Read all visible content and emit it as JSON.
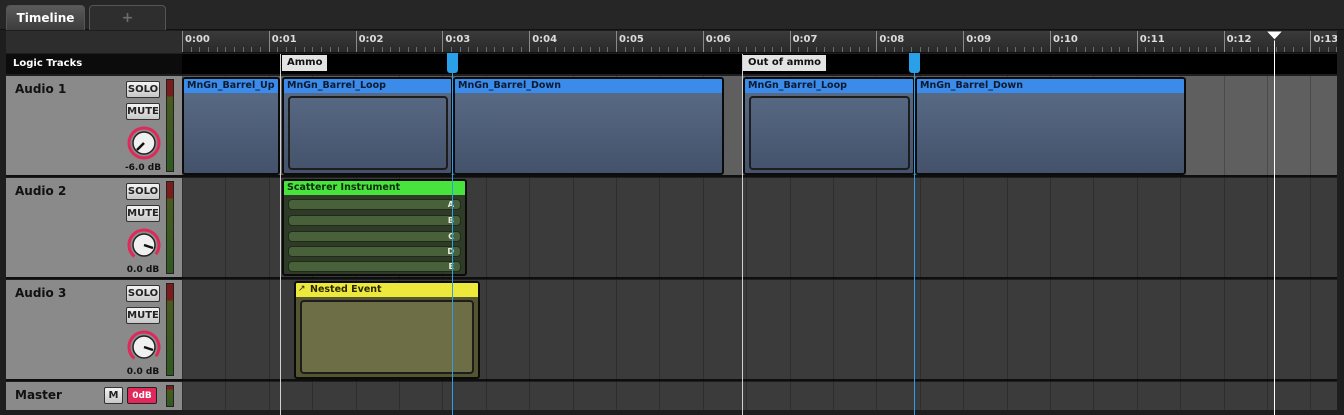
{
  "tabs": {
    "timeline": "Timeline",
    "add": "+"
  },
  "ruler": {
    "labels": [
      "0:00",
      "0:01",
      "0:02",
      "0:03",
      "0:04",
      "0:05",
      "0:06",
      "0:07",
      "0:08",
      "0:09",
      "0:10",
      "0:11",
      "0:12",
      "0:13"
    ],
    "playhead": "0:12.6"
  },
  "logic": {
    "title": "Logic Tracks",
    "markers": [
      {
        "label": "Ammo",
        "time": "0:01"
      },
      {
        "label": "Out of ammo",
        "time": "0:06.7"
      }
    ],
    "loop_start": "0:03.1",
    "loop_end": "0:08.3"
  },
  "tracks": [
    {
      "name": "Audio 1",
      "solo": "SOLO",
      "mute": "MUTE",
      "volume": "-6.0 dB",
      "meter_level": 0.82,
      "clips": [
        {
          "label": "MnGn_Barrel_Up",
          "kind": "single"
        },
        {
          "label": "MnGn_Barrel_Loop",
          "kind": "loop"
        },
        {
          "label": "MnGn_Barrel_Down",
          "kind": "single"
        },
        {
          "label": "MnGn_Barrel_Loop",
          "kind": "loop"
        },
        {
          "label": "MnGn_Barrel_Down",
          "kind": "single"
        }
      ]
    },
    {
      "name": "Audio 2",
      "solo": "SOLO",
      "mute": "MUTE",
      "volume": "0.0 dB",
      "meter_level": 0.82,
      "clips": [
        {
          "label": "Scatterer Instrument",
          "kind": "scatterer",
          "rows": [
            "A",
            "B",
            "C",
            "D",
            "E"
          ]
        }
      ]
    },
    {
      "name": "Audio 3",
      "solo": "SOLO",
      "mute": "MUTE",
      "volume": "0.0 dB",
      "meter_level": 0.82,
      "clips": [
        {
          "label": "Nested Event",
          "kind": "nested",
          "icon": "nested-event-icon"
        }
      ]
    }
  ],
  "master": {
    "name": "Master",
    "mute": "M",
    "volume": "0dB"
  },
  "colors": {
    "clip_header": "#3a8bea",
    "clip_body": "#4f5f7a",
    "scatterer": "#49e33d",
    "nested": "#ece83c",
    "loop_region": "#2aa0e8",
    "knob_ring": "#e0285a"
  }
}
